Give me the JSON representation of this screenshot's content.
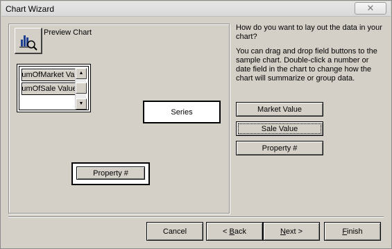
{
  "window": {
    "title": "Chart Wizard",
    "close_glyph": "✕"
  },
  "preview": {
    "label": "Preview Chart",
    "icon": "chart-preview-icon"
  },
  "fields_listbox": {
    "items": [
      "SumOfMarket Value",
      "SumOfSale Value"
    ]
  },
  "drop_zones": {
    "series_label": "Series",
    "axis_field": "Property #"
  },
  "instructions": {
    "question": "How do you want to lay out the data in your chart?",
    "help": "You can drag and drop field buttons to the sample chart. Double-click a number or date field in the chart to change how the chart will summarize or group data."
  },
  "field_buttons": [
    "Market Value",
    "Sale Value",
    "Property #"
  ],
  "buttons": {
    "cancel": "Cancel",
    "back_prefix": "< ",
    "back_key": "B",
    "back_rest": "ack",
    "next_key": "N",
    "next_rest": "ext >",
    "finish_key": "F",
    "finish_rest": "inish"
  }
}
